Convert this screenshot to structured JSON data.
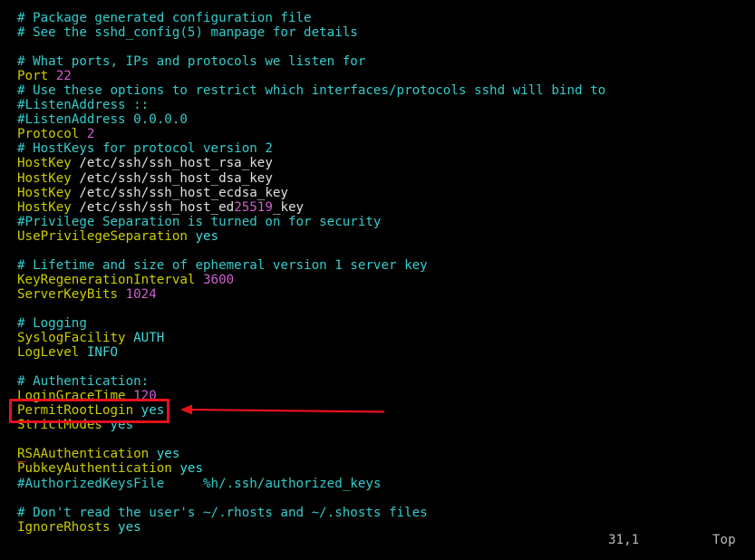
{
  "terminal": {
    "background_color": "#000000",
    "default_text_color": "#d8d8d8",
    "palette": {
      "comment": "#33cccc",
      "keyword": "#cdcd00",
      "value": "#40d8d8",
      "number": "#cd5fcd",
      "plain": "#e0e0e0",
      "annotation_red": "#e8111a"
    }
  },
  "editor": {
    "file_kind": "sshd_config",
    "status": {
      "cursor_position": "31,1",
      "scroll_indicator": "Top"
    }
  },
  "annotation": {
    "highlight_target": "PermitRootLogin yes",
    "shape": "rectangle-with-arrow",
    "color": "#e8111a",
    "arrow_direction": "points-left"
  },
  "lines": [
    {
      "n": 1,
      "segments": [
        {
          "t": "# Package generated configuration file",
          "c": "comment"
        }
      ]
    },
    {
      "n": 2,
      "segments": [
        {
          "t": "# See the sshd_config(5) manpage for details",
          "c": "comment"
        }
      ]
    },
    {
      "n": 3,
      "segments": [
        {
          "t": "",
          "c": "plain"
        }
      ]
    },
    {
      "n": 4,
      "segments": [
        {
          "t": "# What ports, IPs and protocols we listen for",
          "c": "comment"
        }
      ]
    },
    {
      "n": 5,
      "segments": [
        {
          "t": "Port ",
          "c": "keyword"
        },
        {
          "t": "22",
          "c": "number"
        }
      ]
    },
    {
      "n": 6,
      "segments": [
        {
          "t": "# Use these options to restrict which interfaces/protocols sshd will bind to",
          "c": "comment"
        }
      ]
    },
    {
      "n": 7,
      "segments": [
        {
          "t": "#ListenAddress ::",
          "c": "comment"
        }
      ]
    },
    {
      "n": 8,
      "segments": [
        {
          "t": "#ListenAddress 0.0.0.0",
          "c": "comment"
        }
      ]
    },
    {
      "n": 9,
      "segments": [
        {
          "t": "Protocol ",
          "c": "keyword"
        },
        {
          "t": "2",
          "c": "number"
        }
      ]
    },
    {
      "n": 10,
      "segments": [
        {
          "t": "# HostKeys for protocol version 2",
          "c": "comment"
        }
      ]
    },
    {
      "n": 11,
      "segments": [
        {
          "t": "HostKey ",
          "c": "keyword"
        },
        {
          "t": "/etc/ssh/ssh_host_rsa_key",
          "c": "plain"
        }
      ]
    },
    {
      "n": 12,
      "segments": [
        {
          "t": "HostKey ",
          "c": "keyword"
        },
        {
          "t": "/etc/ssh/ssh_host_dsa_key",
          "c": "plain"
        }
      ]
    },
    {
      "n": 13,
      "segments": [
        {
          "t": "HostKey ",
          "c": "keyword"
        },
        {
          "t": "/etc/ssh/ssh_host_ecdsa_key",
          "c": "plain"
        }
      ]
    },
    {
      "n": 14,
      "segments": [
        {
          "t": "HostKey ",
          "c": "keyword"
        },
        {
          "t": "/etc/ssh/ssh_host_ed",
          "c": "plain"
        },
        {
          "t": "25519",
          "c": "number"
        },
        {
          "t": "_key",
          "c": "plain"
        }
      ]
    },
    {
      "n": 15,
      "segments": [
        {
          "t": "#Privilege Separation is turned on for security",
          "c": "comment"
        }
      ]
    },
    {
      "n": 16,
      "segments": [
        {
          "t": "UsePrivilegeSeparation ",
          "c": "keyword"
        },
        {
          "t": "yes",
          "c": "value"
        }
      ]
    },
    {
      "n": 17,
      "segments": [
        {
          "t": "",
          "c": "plain"
        }
      ]
    },
    {
      "n": 18,
      "segments": [
        {
          "t": "# Lifetime and size of ephemeral version 1 server key",
          "c": "comment"
        }
      ]
    },
    {
      "n": 19,
      "segments": [
        {
          "t": "KeyRegenerationInterval ",
          "c": "keyword"
        },
        {
          "t": "3600",
          "c": "number"
        }
      ]
    },
    {
      "n": 20,
      "segments": [
        {
          "t": "ServerKeyBits ",
          "c": "keyword"
        },
        {
          "t": "1024",
          "c": "number"
        }
      ]
    },
    {
      "n": 21,
      "segments": [
        {
          "t": "",
          "c": "plain"
        }
      ]
    },
    {
      "n": 22,
      "segments": [
        {
          "t": "# Logging",
          "c": "comment"
        }
      ]
    },
    {
      "n": 23,
      "segments": [
        {
          "t": "SyslogFacility ",
          "c": "keyword"
        },
        {
          "t": "AUTH",
          "c": "value"
        }
      ]
    },
    {
      "n": 24,
      "segments": [
        {
          "t": "LogLevel ",
          "c": "keyword"
        },
        {
          "t": "INFO",
          "c": "value"
        }
      ]
    },
    {
      "n": 25,
      "segments": [
        {
          "t": "",
          "c": "plain"
        }
      ]
    },
    {
      "n": 26,
      "segments": [
        {
          "t": "# Authentication:",
          "c": "comment"
        }
      ]
    },
    {
      "n": 27,
      "segments": [
        {
          "t": "LoginGraceTime ",
          "c": "keyword"
        },
        {
          "t": "120",
          "c": "number"
        }
      ]
    },
    {
      "n": 28,
      "segments": [
        {
          "t": "PermitRootLogin ",
          "c": "keyword"
        },
        {
          "t": "yes",
          "c": "value"
        }
      ]
    },
    {
      "n": 29,
      "segments": [
        {
          "t": "StrictModes ",
          "c": "keyword"
        },
        {
          "t": "yes",
          "c": "value"
        }
      ]
    },
    {
      "n": 30,
      "segments": [
        {
          "t": "",
          "c": "plain"
        }
      ]
    },
    {
      "n": 31,
      "segments": [
        {
          "t": "R",
          "c": "spell"
        },
        {
          "t": "SAAuthentication ",
          "c": "keyword"
        },
        {
          "t": "yes",
          "c": "value"
        }
      ]
    },
    {
      "n": 32,
      "segments": [
        {
          "t": "PubkeyAuthentication ",
          "c": "keyword"
        },
        {
          "t": "yes",
          "c": "value"
        }
      ]
    },
    {
      "n": 33,
      "segments": [
        {
          "t": "#AuthorizedKeysFile     %h/.ssh/authorized_keys",
          "c": "comment"
        }
      ]
    },
    {
      "n": 34,
      "segments": [
        {
          "t": "",
          "c": "plain"
        }
      ]
    },
    {
      "n": 35,
      "segments": [
        {
          "t": "# Don't read the user's ~/.rhosts and ~/.shosts files",
          "c": "comment"
        }
      ]
    },
    {
      "n": 36,
      "segments": [
        {
          "t": "IgnoreRhosts ",
          "c": "keyword"
        },
        {
          "t": "yes",
          "c": "value"
        }
      ]
    }
  ]
}
